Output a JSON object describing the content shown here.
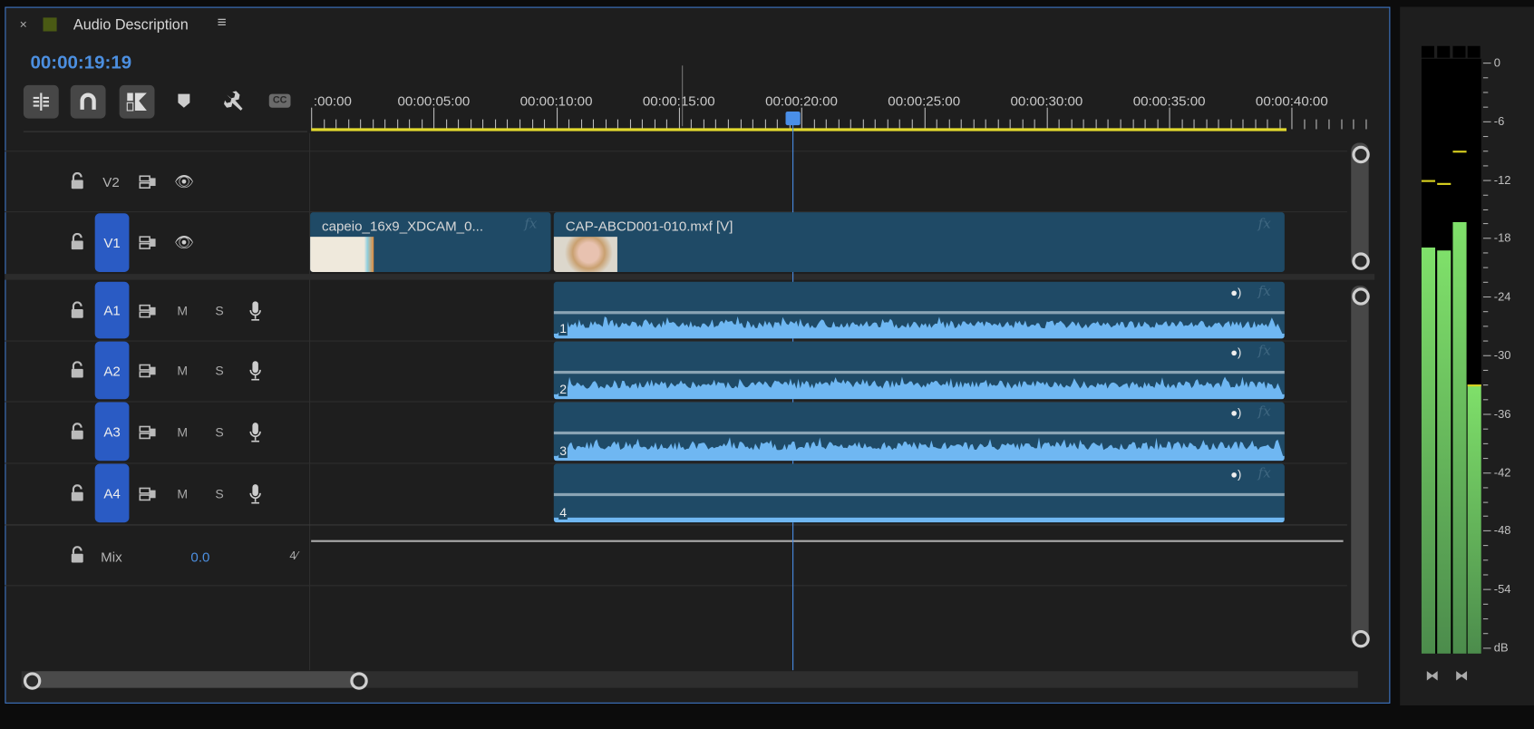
{
  "panel": {
    "title": "Audio Description",
    "timecode": "00:00:19:19",
    "label_color": "#4a5a14",
    "accent": "#3f78c9"
  },
  "toolbar": [
    {
      "icon": "insert-nest-icon"
    },
    {
      "icon": "snap-magnet-icon"
    },
    {
      "icon": "linked-selection-icon"
    },
    {
      "icon": "marker-icon"
    },
    {
      "icon": "wrench-settings-icon"
    },
    {
      "icon": "captions-cc-icon",
      "text": "CC"
    }
  ],
  "ruler": {
    "labels": [
      ":00:00",
      "00:00:05:00",
      "00:00:10:00",
      "00:00:15:00",
      "00:00:20:00",
      "00:00:25:00",
      "00:00:30:00",
      "00:00:35:00",
      "00:00:40:00"
    ],
    "playhead_seconds": 19.8
  },
  "tracks": {
    "video": [
      {
        "name": "V2",
        "targeted": false
      },
      {
        "name": "V1",
        "targeted": true
      }
    ],
    "audio": [
      {
        "name": "A1",
        "m": "M",
        "s": "S"
      },
      {
        "name": "A2",
        "m": "M",
        "s": "S"
      },
      {
        "name": "A3",
        "m": "M",
        "s": "S"
      },
      {
        "name": "A4",
        "m": "M",
        "s": "S"
      }
    ],
    "mix": {
      "label": "Mix",
      "value": "0.0"
    }
  },
  "clips": {
    "video": [
      {
        "name": "capeio_16x9_XDCAM_0...",
        "fx": "fx"
      },
      {
        "name": "CAP-ABCD001-010.mxf [V]",
        "fx": "fx"
      }
    ],
    "audio": [
      {
        "channel": "1",
        "fx": "fx"
      },
      {
        "channel": "2",
        "fx": "fx"
      },
      {
        "channel": "3",
        "fx": "fx"
      },
      {
        "channel": "4",
        "fx": "fx"
      }
    ]
  },
  "meter": {
    "scale": [
      "0",
      "-6",
      "-12",
      "-18",
      "-24",
      "-30",
      "-36",
      "-42",
      "-48",
      "-54",
      "dB"
    ],
    "levels_db": [
      -19,
      -19.3,
      -16.4,
      -33
    ],
    "peaks_db": [
      -12,
      -12.3,
      -9,
      -33
    ],
    "colors": {
      "level": "#6fd35e",
      "peak": "#d8d020"
    }
  }
}
